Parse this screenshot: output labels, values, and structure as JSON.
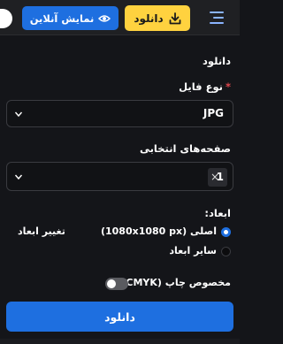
{
  "header": {
    "preview_label": "نمایش آنلاین",
    "download_label": "دانلود",
    "icons": [
      "eye-icon",
      "download-icon",
      "menu-icon"
    ]
  },
  "panel": {
    "title": "دانلود",
    "file_type": {
      "label": "نوع فایل",
      "required_mark": "*",
      "value": "JPG"
    },
    "pages": {
      "label": "صفحه‌های انتخابی",
      "tag": "1",
      "remove_glyph": "×"
    },
    "dimensions": {
      "label": "ابعاد:",
      "option_original": "اصلی (1080x1080 px)",
      "option_other": "سایر ابعاد",
      "resize_label": "تغییر ابعاد",
      "selected": "original"
    },
    "print": {
      "label": "مخصوص چاپ (CMYK)",
      "enabled": false
    },
    "download_button": "دانلود"
  },
  "colors": {
    "accent_blue": "#1e6fe0",
    "accent_yellow": "#ffd23f",
    "background": "#141519",
    "required_red": "#e0464d"
  }
}
